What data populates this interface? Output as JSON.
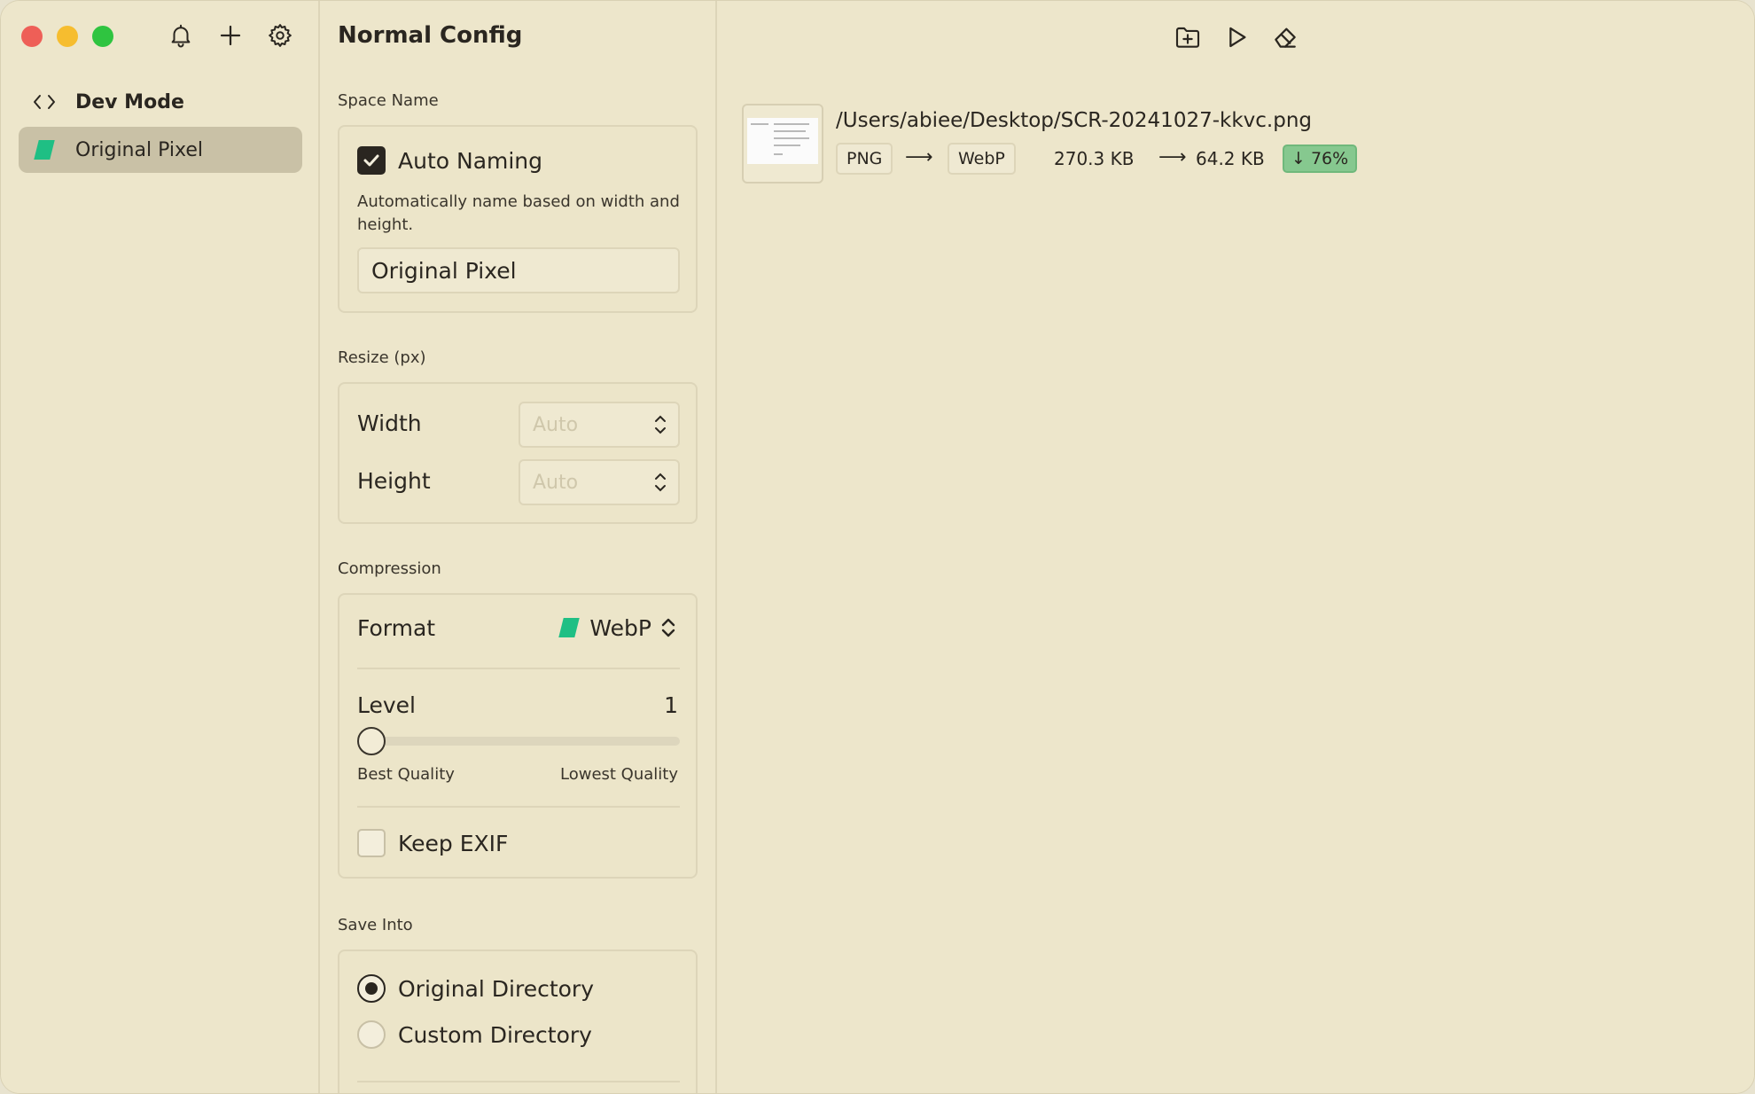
{
  "sidebar": {
    "items": [
      {
        "label": "Dev Mode",
        "icon": "code-icon",
        "active": false
      },
      {
        "label": "Original Pixel",
        "icon": "swatch-icon",
        "active": true
      }
    ]
  },
  "config": {
    "title": "Normal Config",
    "space_name": {
      "section_label": "Space Name",
      "auto_naming_label": "Auto Naming",
      "auto_naming_checked": true,
      "hint": "Automatically name based on width and height.",
      "name_value": "Original Pixel"
    },
    "resize": {
      "section_label": "Resize (px)",
      "width_label": "Width",
      "width_placeholder": "Auto",
      "height_label": "Height",
      "height_placeholder": "Auto"
    },
    "compression": {
      "section_label": "Compression",
      "format_label": "Format",
      "format_value": "WebP",
      "level_label": "Level",
      "level_value": "1",
      "level_fraction": 0,
      "min_label": "Best Quality",
      "max_label": "Lowest Quality",
      "keep_exif_label": "Keep EXIF",
      "keep_exif_checked": false
    },
    "save_into": {
      "section_label": "Save Into",
      "options": [
        {
          "label": "Original Directory",
          "selected": true
        },
        {
          "label": "Custom Directory",
          "selected": false
        }
      ]
    }
  },
  "toolbar": {
    "icons": [
      "add-folder-icon",
      "play-icon",
      "eraser-icon"
    ]
  },
  "files": [
    {
      "path": "/Users/abiee/Desktop/SCR-20241027-kkvc.png",
      "from_format": "PNG",
      "to_format": "WebP",
      "original_size": "270.3 KB",
      "new_size": "64.2 KB",
      "saving": "↓ 76%"
    }
  ],
  "colors": {
    "background": "#ede6cb",
    "active_item": "#c9c1a6",
    "accent_green": "#1fbf84",
    "saving_badge": "#86c88f"
  }
}
